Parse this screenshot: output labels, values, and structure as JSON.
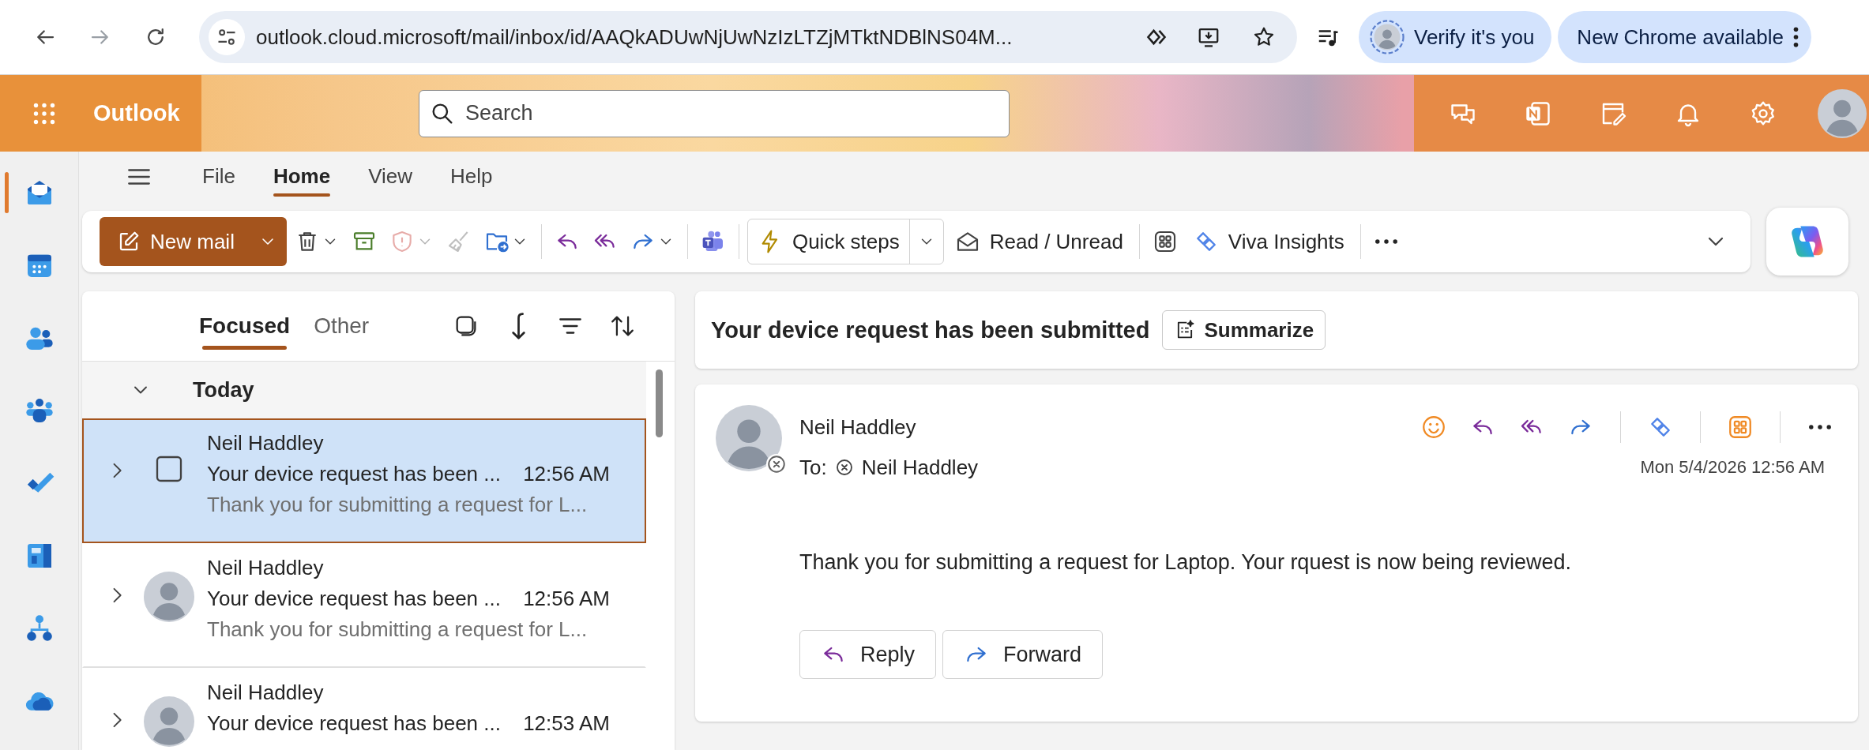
{
  "browser": {
    "url": "outlook.cloud.microsoft/mail/inbox/id/AAQkADUwNjUwNzIzLTZjMTktNDBlNS04M...",
    "verify_button": "Verify it's you",
    "update_button": "New Chrome available"
  },
  "header": {
    "app_name": "Outlook",
    "search": {
      "placeholder": "Search"
    }
  },
  "rail": [
    {
      "kind": "mail",
      "selected": true
    },
    {
      "kind": "calendar",
      "selected": false
    },
    {
      "kind": "people",
      "selected": false
    },
    {
      "kind": "groups",
      "selected": false
    },
    {
      "kind": "todo",
      "selected": false
    },
    {
      "kind": "apps",
      "selected": false
    },
    {
      "kind": "org",
      "selected": false
    },
    {
      "kind": "cloud",
      "selected": false
    }
  ],
  "menu_tabs": [
    {
      "label": "File",
      "selected": false
    },
    {
      "label": "Home",
      "selected": true
    },
    {
      "label": "View",
      "selected": false
    },
    {
      "label": "Help",
      "selected": false
    }
  ],
  "ribbon": {
    "groups": [
      [
        {
          "kind": "new_mail",
          "label": "New mail"
        },
        {
          "kind": "delete",
          "dropdown": true,
          "disabled": false
        },
        {
          "kind": "archive",
          "dropdown": false,
          "disabled": false
        },
        {
          "kind": "report",
          "dropdown": true,
          "disabled": true
        },
        {
          "kind": "sweep",
          "dropdown": false,
          "disabled": true
        },
        {
          "kind": "move",
          "dropdown": true,
          "disabled": false
        }
      ],
      [
        {
          "kind": "reply",
          "dropdown": false,
          "disabled": false
        },
        {
          "kind": "reply_all",
          "dropdown": false,
          "disabled": false
        },
        {
          "kind": "forward",
          "dropdown": true,
          "disabled": false
        }
      ],
      [
        {
          "kind": "teams",
          "dropdown": false,
          "disabled": false
        }
      ],
      [
        {
          "kind": "quick_steps",
          "label": "Quick steps"
        },
        {
          "kind": "read_unread",
          "label": "Read / Unread"
        }
      ],
      [
        {
          "kind": "apps",
          "dropdown": false,
          "disabled": false
        },
        {
          "kind": "viva_insights",
          "label": "Viva Insights"
        }
      ],
      [
        {
          "kind": "more",
          "dropdown": false,
          "disabled": false
        }
      ],
      [
        {
          "kind": "expand",
          "dropdown": false,
          "disabled": false
        }
      ]
    ]
  },
  "list": {
    "tabs": [
      {
        "label": "Focused",
        "selected": true
      },
      {
        "label": "Other",
        "selected": false
      }
    ],
    "group": {
      "label": "Today",
      "expanded": true
    },
    "messages": [
      {
        "sender": "Neil Haddley",
        "subject": "Your device request has been ...",
        "time": "12:56 AM",
        "preview": "Thank you for submitting a request for L...",
        "selected": true
      },
      {
        "sender": "Neil Haddley",
        "subject": "Your device request has been ...",
        "time": "12:56 AM",
        "preview": "Thank you for submitting a request for L...",
        "selected": false
      },
      {
        "sender": "Neil Haddley",
        "subject": "Your device request has been ...",
        "time": "12:53 AM",
        "selected": false
      }
    ]
  },
  "reading": {
    "subject": "Your device request has been submitted",
    "summarize_button": "Summarize",
    "sender": "Neil Haddley",
    "to_label": "To:",
    "recipient": "Neil Haddley",
    "date": "Mon 5/4/2026 12:56 AM",
    "body": "Thank you for submitting a request for Laptop. Your rquest is now being reviewed.",
    "reply_button": "Reply",
    "forward_button": "Forward"
  }
}
